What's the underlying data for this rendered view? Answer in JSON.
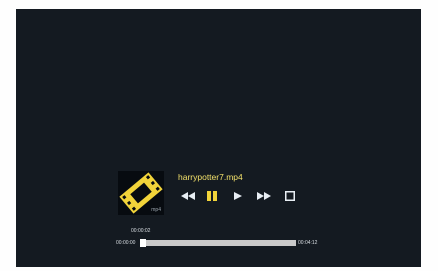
{
  "player": {
    "file_name": "harrypotter7.mp4",
    "thumbnail": {
      "icon": "film-strip-icon",
      "extension": "mp4"
    },
    "controls": [
      {
        "name": "rewind-button",
        "icon": "rewind-icon"
      },
      {
        "name": "pause-button",
        "icon": "pause-icon"
      },
      {
        "name": "play-button",
        "icon": "play-icon"
      },
      {
        "name": "fast-forward-button",
        "icon": "fast-forward-icon"
      },
      {
        "name": "stop-button",
        "icon": "stop-icon"
      }
    ],
    "current_time": "00:00:02",
    "start_time": "00:00:00",
    "end_time": "00:04:12",
    "progress_fraction": 0.008
  },
  "colors": {
    "background": "#141a21",
    "title": "#f2e06a",
    "icon": "#e8eef4",
    "accent": "#f2d43a"
  }
}
